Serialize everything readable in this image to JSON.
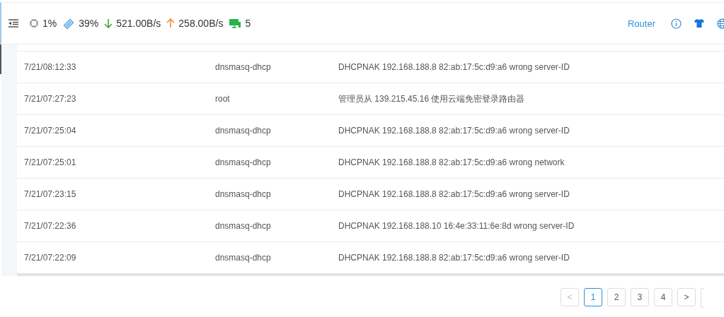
{
  "header": {
    "cpu": "1%",
    "memory": "39%",
    "download": "521.00B/s",
    "upload": "258.00B/s",
    "devices": "5",
    "router": "Router"
  },
  "table": {
    "rows": [
      {
        "time": "7/21/08:12:33",
        "source": "dnsmasq-dhcp",
        "message": "DHCPNAK 192.168.188.8 82:ab:17:5c:d9:a6 wrong server-ID"
      },
      {
        "time": "7/21/07:27:23",
        "source": "root",
        "message": "管理员从 139.215.45.16 使用云端免密登录路由器"
      },
      {
        "time": "7/21/07:25:04",
        "source": "dnsmasq-dhcp",
        "message": "DHCPNAK 192.168.188.8 82:ab:17:5c:d9:a6 wrong server-ID"
      },
      {
        "time": "7/21/07:25:01",
        "source": "dnsmasq-dhcp",
        "message": "DHCPNAK 192.168.188.8 82:ab:17:5c:d9:a6 wrong network"
      },
      {
        "time": "7/21/07:23:15",
        "source": "dnsmasq-dhcp",
        "message": "DHCPNAK 192.168.188.8 82:ab:17:5c:d9:a6 wrong server-ID"
      },
      {
        "time": "7/21/07:22:36",
        "source": "dnsmasq-dhcp",
        "message": "DHCPNAK 192.168.188.10 16:4e:33:11:6e:8d wrong server-ID"
      },
      {
        "time": "7/21/07:22:09",
        "source": "dnsmasq-dhcp",
        "message": "DHCPNAK 192.168.188.8 82:ab:17:5c:d9:a6 wrong server-ID"
      }
    ]
  },
  "pagination": {
    "prev": "<",
    "pages": [
      {
        "label": "1",
        "selected": true
      },
      {
        "label": "2",
        "selected": false
      },
      {
        "label": "3",
        "selected": false
      },
      {
        "label": "4",
        "selected": false
      }
    ],
    "next": ">"
  }
}
